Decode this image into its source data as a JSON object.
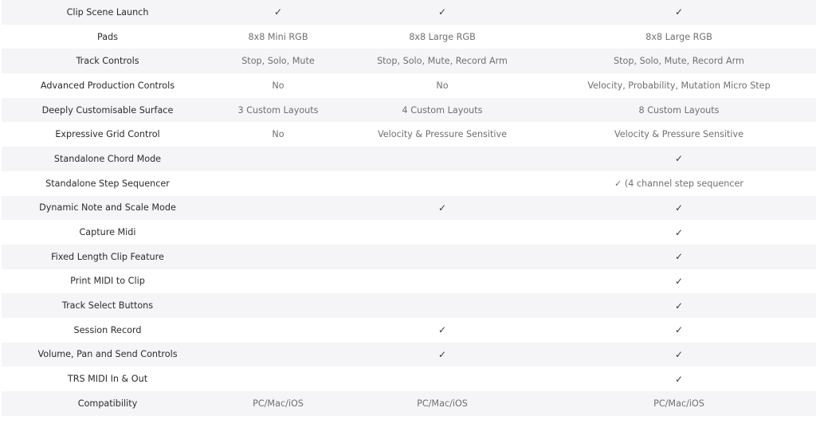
{
  "table": {
    "rows": [
      {
        "feature": "Clip Scene Launch",
        "c1": "✓",
        "c2": "✓",
        "c3": "✓"
      },
      {
        "feature": "Pads",
        "c1": "8x8 Mini RGB",
        "c2": "8x8 Large RGB",
        "c3": "8x8 Large RGB"
      },
      {
        "feature": "Track Controls",
        "c1": "Stop, Solo, Mute",
        "c2": "Stop, Solo, Mute, Record Arm",
        "c3": "Stop, Solo, Mute, Record Arm"
      },
      {
        "feature": "Advanced Production Controls",
        "c1": "No",
        "c2": "No",
        "c3": "Velocity, Probability, Mutation Micro Step"
      },
      {
        "feature": "Deeply Customisable Surface",
        "c1": "3 Custom Layouts",
        "c2": "4 Custom Layouts",
        "c3": "8 Custom Layouts"
      },
      {
        "feature": "Expressive Grid Control",
        "c1": "No",
        "c2": "Velocity & Pressure Sensitive",
        "c3": "Velocity & Pressure Sensitive"
      },
      {
        "feature": "Standalone Chord Mode",
        "c1": "",
        "c2": "",
        "c3": "✓"
      },
      {
        "feature": "Standalone Step Sequencer",
        "c1": "",
        "c2": "",
        "c3": "✓ (4 channel step sequencer"
      },
      {
        "feature": "Dynamic Note and Scale Mode",
        "c1": "",
        "c2": "✓",
        "c3": "✓"
      },
      {
        "feature": "Capture Midi",
        "c1": "",
        "c2": "",
        "c3": "✓"
      },
      {
        "feature": "Fixed Length Clip Feature",
        "c1": "",
        "c2": "",
        "c3": "✓"
      },
      {
        "feature": "Print MIDI to Clip",
        "c1": "",
        "c2": "",
        "c3": "✓"
      },
      {
        "feature": "Track Select Buttons",
        "c1": "",
        "c2": "",
        "c3": "✓"
      },
      {
        "feature": "Session Record",
        "c1": "",
        "c2": "✓",
        "c3": "✓"
      },
      {
        "feature": "Volume, Pan and Send Controls",
        "c1": "",
        "c2": "✓",
        "c3": "✓"
      },
      {
        "feature": "TRS MIDI In & Out",
        "c1": "",
        "c2": "",
        "c3": "✓"
      },
      {
        "feature": "Compatibility",
        "c1": "PC/Mac/iOS",
        "c2": "PC/Mac/iOS",
        "c3": "PC/Mac/iOS"
      }
    ]
  },
  "colors": {
    "alt_row": "#f5f5f7",
    "label_text": "#2b2b2b",
    "value_text": "#707070"
  }
}
